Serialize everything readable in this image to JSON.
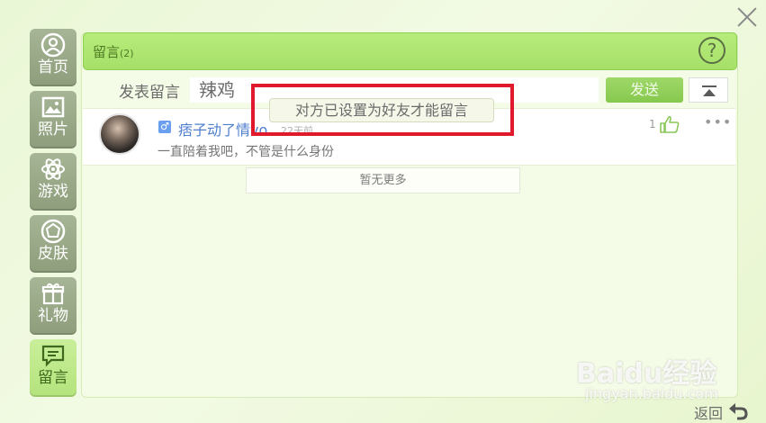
{
  "sidebar": {
    "items": [
      {
        "label": "首页",
        "icon": "user-icon"
      },
      {
        "label": "照片",
        "icon": "photo-icon"
      },
      {
        "label": "游戏",
        "icon": "atom-icon"
      },
      {
        "label": "皮肤",
        "icon": "gem-icon"
      },
      {
        "label": "礼物",
        "icon": "gift-icon"
      },
      {
        "label": "留言",
        "icon": "message-icon",
        "active": true
      }
    ]
  },
  "header": {
    "title": "留言",
    "count": "(2)",
    "help": "?"
  },
  "compose": {
    "label": "发表留言",
    "input_value": "辣鸡",
    "send": "发送"
  },
  "message": {
    "username": "痞子动了情vo",
    "time": "22天前",
    "text": "一直陪着我吧，不管是什么身份",
    "likes": "1",
    "more": "•••"
  },
  "no_more": "暂无更多",
  "toast": "对方已设置为好友才能留言",
  "back": "返回",
  "watermark": {
    "brand": "Baidu经验",
    "url": "jingyan.baidu.com"
  },
  "colors": {
    "accent": "#a6e068",
    "highlight": "#e1192c",
    "username": "#4f7fcf"
  }
}
